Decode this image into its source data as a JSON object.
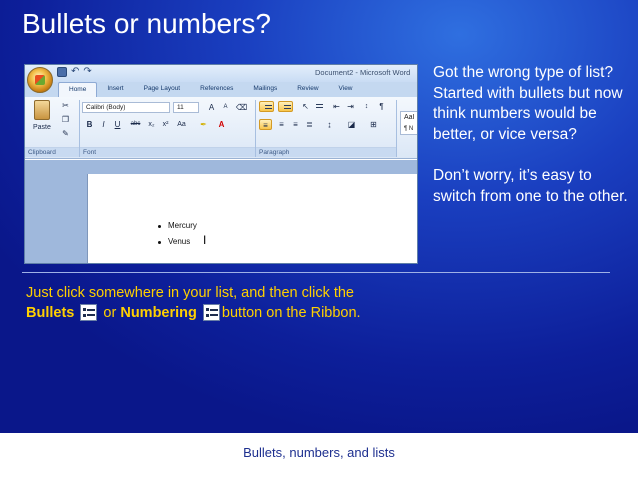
{
  "slide": {
    "title": "Bullets or numbers?",
    "right_text": [
      "Got the wrong type of list? Started with bullets but now think numbers would be better, or vice versa?",
      "Don’t worry, it’s easy to switch from one to the other."
    ],
    "bottom": {
      "line1": "Just click somewhere in your list, and then click the",
      "bullets": "Bullets",
      "or": "or",
      "numbering": "Numbering",
      "button_text": "button on the Ribbon."
    },
    "footer": "Bullets, numbers, and lists"
  },
  "word": {
    "doc_title": "Document2 - Microsoft Word",
    "tabs": [
      "Home",
      "Insert",
      "Page Layout",
      "References",
      "Mailings",
      "Review",
      "View"
    ],
    "font_name": "Calibri (Body)",
    "font_size": "11",
    "paste_label": "Paste",
    "groups": {
      "clipboard": "Clipboard",
      "font": "Font",
      "paragraph": "Paragraph"
    },
    "style_preview": "AaI",
    "style_label": "¶ N",
    "doc_items": [
      "Mercury",
      "Venus"
    ]
  },
  "colors": {
    "slide_bg": "#1a3fc0",
    "title": "#ffffff",
    "highlight": "#ffd000",
    "footer": "#1d2f8f"
  }
}
